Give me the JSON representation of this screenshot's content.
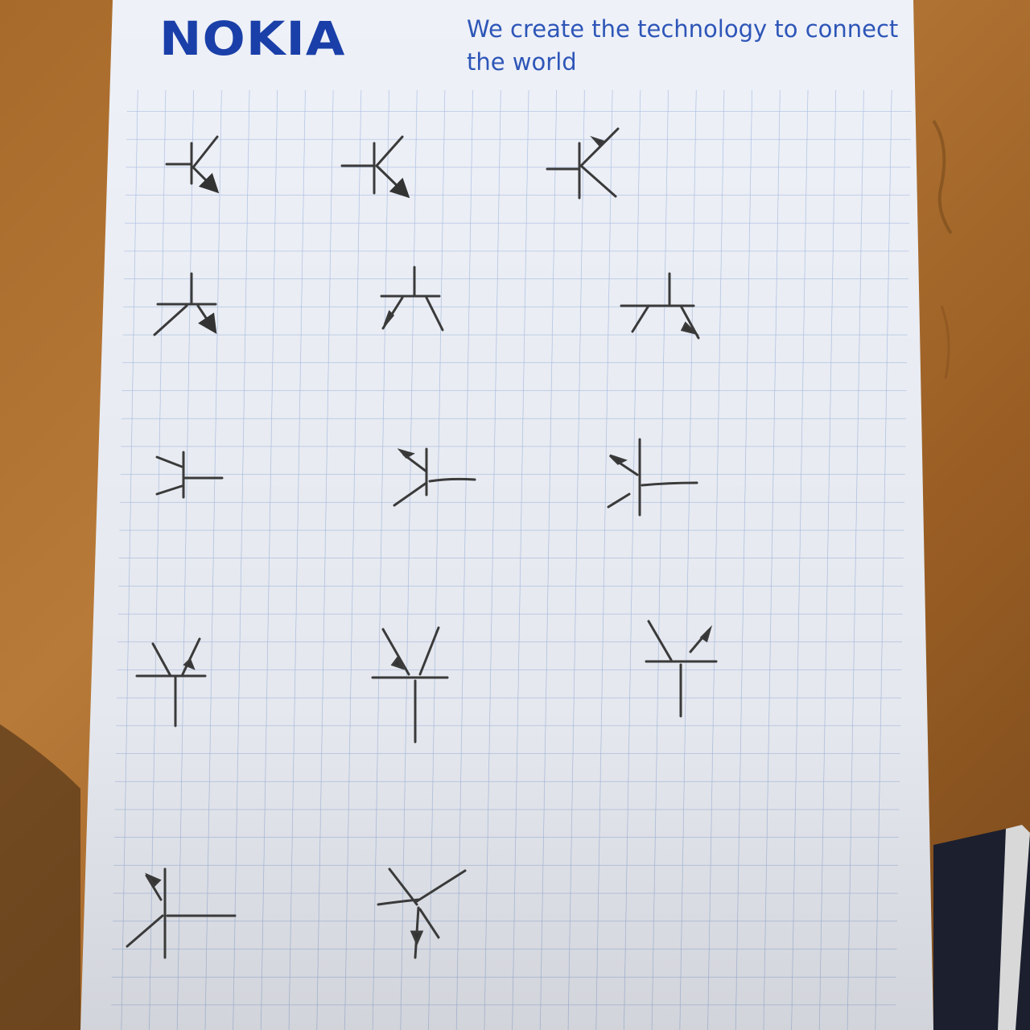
{
  "colors": {
    "desk": "#a86a2a",
    "paper": "#eef1f8",
    "grid": "#9fb5dc",
    "ink": "#3c3c3c",
    "brand_blue": "#1a3fa8"
  },
  "header": {
    "logo_text": "NOKIA",
    "tagline_line1": "We create the technology to connect",
    "tagline_line2": "the world"
  },
  "sketch": {
    "subject": "hand-drawn transistor symbols, 14 sketches in 5 rows",
    "sketch_count": 14
  }
}
